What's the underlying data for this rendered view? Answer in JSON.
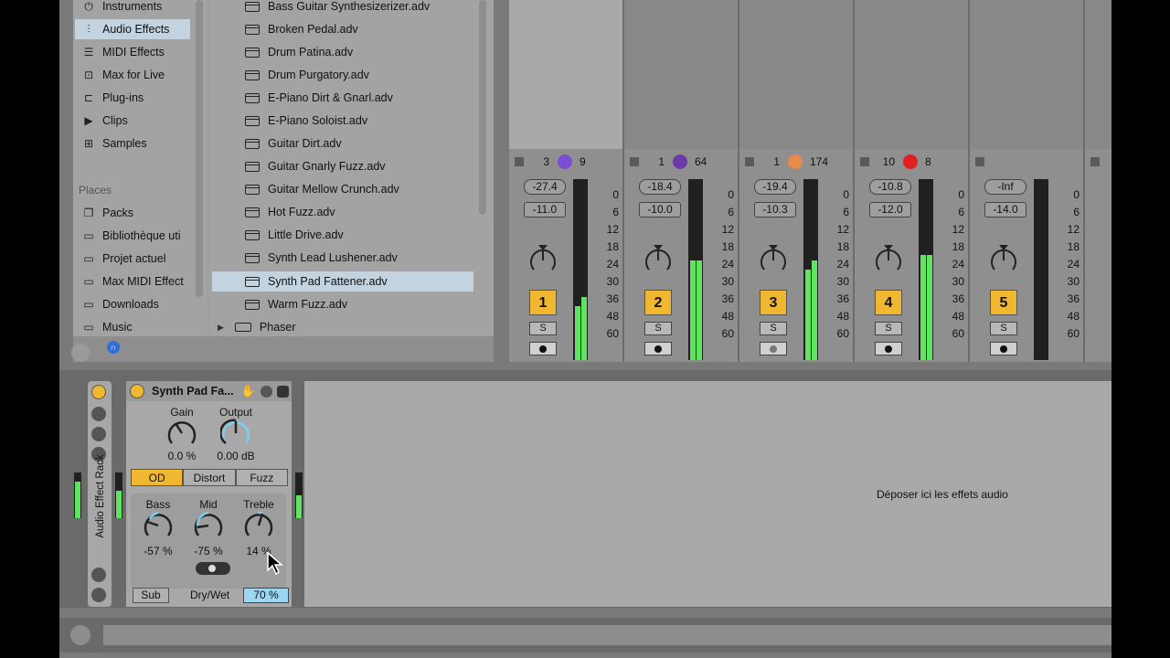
{
  "browser": {
    "categories": [
      {
        "label": "Instruments",
        "icon": "clock-icon"
      },
      {
        "label": "Audio Effects",
        "icon": "waveform-icon",
        "selected": true
      },
      {
        "label": "MIDI Effects",
        "icon": "midi-icon"
      },
      {
        "label": "Max for Live",
        "icon": "max-icon"
      },
      {
        "label": "Plug-ins",
        "icon": "plug-icon"
      },
      {
        "label": "Clips",
        "icon": "play-icon"
      },
      {
        "label": "Samples",
        "icon": "sample-icon"
      }
    ],
    "places_title": "Places",
    "places": [
      {
        "label": "Packs",
        "icon": "packs-icon"
      },
      {
        "label": "Bibliothèque uti",
        "icon": "folder-icon"
      },
      {
        "label": "Projet actuel",
        "icon": "folder-icon"
      },
      {
        "label": "Max MIDI Effect",
        "icon": "folder-icon"
      },
      {
        "label": "Downloads",
        "icon": "folder-icon"
      },
      {
        "label": "Music",
        "icon": "folder-icon"
      }
    ],
    "files": [
      {
        "label": "Bass Guitar Synthesizerizer.adv"
      },
      {
        "label": "Broken Pedal.adv"
      },
      {
        "label": "Drum Patina.adv"
      },
      {
        "label": "Drum Purgatory.adv"
      },
      {
        "label": "E-Piano Dirt & Gnarl.adv"
      },
      {
        "label": "E-Piano Soloist.adv"
      },
      {
        "label": "Guitar Dirt.adv"
      },
      {
        "label": "Guitar Gnarly Fuzz.adv"
      },
      {
        "label": "Guitar Mellow Crunch.adv"
      },
      {
        "label": "Hot Fuzz.adv"
      },
      {
        "label": "Little Drive.adv"
      },
      {
        "label": "Synth Lead Lushener.adv"
      },
      {
        "label": "Synth Pad Fattener.adv",
        "selected": true
      },
      {
        "label": "Warm Fuzz.adv"
      }
    ],
    "folder_item": "Phaser"
  },
  "mixer": {
    "scale": [
      "0",
      "6",
      "12",
      "18",
      "24",
      "30",
      "36",
      "48",
      "60"
    ],
    "tracks": [
      {
        "send_a": "3",
        "send_b": "9",
        "dot_color": "#7a4fd6",
        "vol_peak": "-27.4",
        "vol": "-11.0",
        "number": "1",
        "solo": "S",
        "meter_l": 0.3,
        "meter_r": 0.35
      },
      {
        "send_a": "1",
        "send_b": "64",
        "dot_color": "#6a3aa8",
        "vol_peak": "-18.4",
        "vol": "-10.0",
        "number": "2",
        "solo": "S",
        "meter_l": 0.55,
        "meter_r": 0.55
      },
      {
        "send_a": "1",
        "send_b": "174",
        "dot_color": "#e88a4a",
        "vol_peak": "-19.4",
        "vol": "-10.3",
        "number": "3",
        "solo": "S",
        "meter_l": 0.5,
        "meter_r": 0.55
      },
      {
        "send_a": "10",
        "send_b": "8",
        "dot_color": "#e02020",
        "vol_peak": "-10.8",
        "vol": "-12.0",
        "number": "4",
        "solo": "S",
        "meter_l": 0.58,
        "meter_r": 0.58
      },
      {
        "send_a": "",
        "send_b": "",
        "dot_color": "",
        "vol_peak": "-Inf",
        "vol": "-14.0",
        "number": "5",
        "solo": "S",
        "meter_l": 0,
        "meter_r": 0
      }
    ]
  },
  "rack": {
    "title": "Audio Effect Rack"
  },
  "device": {
    "title": "Synth Pad Fa...",
    "gain_label": "Gain",
    "gain_value": "0.0 %",
    "output_label": "Output",
    "output_value": "0.00 dB",
    "tabs": [
      "OD",
      "Distort",
      "Fuzz"
    ],
    "active_tab": "OD",
    "bass_label": "Bass",
    "bass_value": "-57 %",
    "mid_label": "Mid",
    "mid_value": "-75 %",
    "treble_label": "Treble",
    "treble_value": "14 %",
    "sub_label": "Sub",
    "drywet_label": "Dry/Wet",
    "drywet_value": "70 %"
  },
  "dropzone": {
    "text": "Déposer ici les effets audio"
  },
  "colors": {
    "accent": "#f0b730",
    "selection": "#c3d3e0",
    "meter": "#5fe45f",
    "knob_ring": "#7fcdf0"
  }
}
